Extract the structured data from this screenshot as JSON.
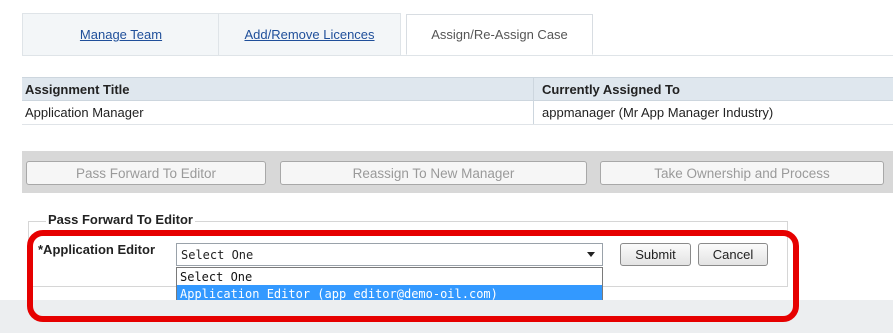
{
  "tabs": [
    {
      "label": "Manage Team",
      "active": false
    },
    {
      "label": "Add/Remove Licences",
      "active": false
    },
    {
      "label": "Assign/Re-Assign Case",
      "active": true
    }
  ],
  "assignment_table": {
    "headers": [
      "Assignment Title",
      "Currently Assigned To"
    ],
    "rows": [
      [
        "Application Manager",
        "appmanager (Mr App Manager Industry)"
      ]
    ]
  },
  "actions": {
    "pass_forward": "Pass Forward To Editor",
    "reassign": "Reassign To New Manager",
    "take_ownership": "Take Ownership and Process"
  },
  "pass_forward_section": {
    "legend": "Pass Forward To Editor",
    "field_label": "*Application Editor",
    "selected": "Select One",
    "options": [
      "Select One",
      "Application Editor (app_editor@demo-oil.com)"
    ],
    "highlighted_option": "Application Editor (app_editor@demo-oil.com)",
    "submit_label": "Submit",
    "cancel_label": "Cancel"
  },
  "colors": {
    "link": "#1f4f9a",
    "table_header_bg": "#dfe7ee",
    "option_highlight": "#3399ff",
    "annotation": "#e60000"
  }
}
